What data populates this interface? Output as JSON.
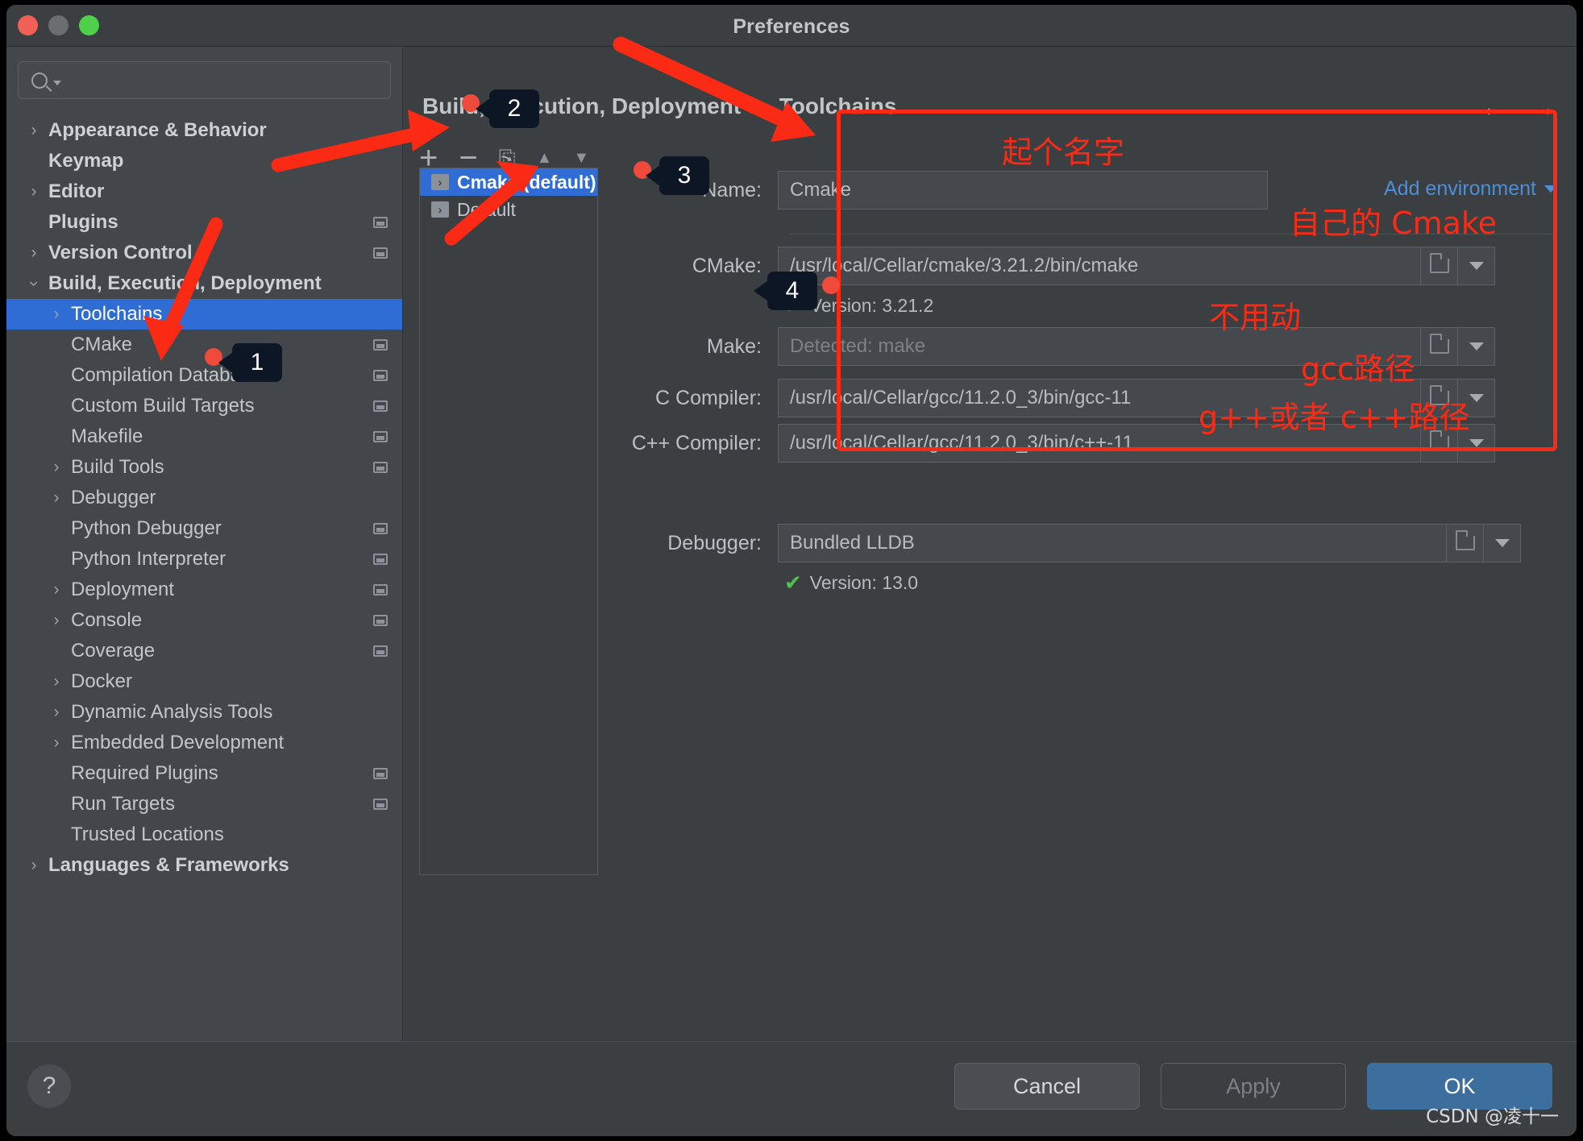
{
  "window": {
    "title": "Preferences",
    "traffic_lights": [
      "close",
      "minimize",
      "zoom"
    ]
  },
  "sidebar": {
    "search": {
      "value": "",
      "placeholder": ""
    },
    "items": [
      {
        "label": "Appearance & Behavior",
        "chevron": "right",
        "bold": true,
        "indent": 0,
        "mini": false,
        "selected": false
      },
      {
        "label": "Keymap",
        "chevron": "none",
        "bold": true,
        "indent": 0,
        "mini": false,
        "selected": false
      },
      {
        "label": "Editor",
        "chevron": "right",
        "bold": true,
        "indent": 0,
        "mini": false,
        "selected": false
      },
      {
        "label": "Plugins",
        "chevron": "none",
        "bold": true,
        "indent": 0,
        "mini": true,
        "selected": false
      },
      {
        "label": "Version Control",
        "chevron": "right",
        "bold": true,
        "indent": 0,
        "mini": true,
        "selected": false
      },
      {
        "label": "Build, Execution, Deployment",
        "chevron": "down",
        "bold": true,
        "indent": 0,
        "mini": false,
        "selected": false
      },
      {
        "label": "Toolchains",
        "chevron": "right",
        "bold": false,
        "indent": 1,
        "mini": false,
        "selected": true
      },
      {
        "label": "CMake",
        "chevron": "none",
        "bold": false,
        "indent": 1,
        "mini": true,
        "selected": false
      },
      {
        "label": "Compilation Database",
        "chevron": "none",
        "bold": false,
        "indent": 1,
        "mini": true,
        "selected": false
      },
      {
        "label": "Custom Build Targets",
        "chevron": "none",
        "bold": false,
        "indent": 1,
        "mini": true,
        "selected": false
      },
      {
        "label": "Makefile",
        "chevron": "none",
        "bold": false,
        "indent": 1,
        "mini": true,
        "selected": false
      },
      {
        "label": "Build Tools",
        "chevron": "right",
        "bold": false,
        "indent": 1,
        "mini": true,
        "selected": false
      },
      {
        "label": "Debugger",
        "chevron": "right",
        "bold": false,
        "indent": 1,
        "mini": false,
        "selected": false
      },
      {
        "label": "Python Debugger",
        "chevron": "none",
        "bold": false,
        "indent": 1,
        "mini": true,
        "selected": false
      },
      {
        "label": "Python Interpreter",
        "chevron": "none",
        "bold": false,
        "indent": 1,
        "mini": true,
        "selected": false
      },
      {
        "label": "Deployment",
        "chevron": "right",
        "bold": false,
        "indent": 1,
        "mini": true,
        "selected": false
      },
      {
        "label": "Console",
        "chevron": "right",
        "bold": false,
        "indent": 1,
        "mini": true,
        "selected": false
      },
      {
        "label": "Coverage",
        "chevron": "none",
        "bold": false,
        "indent": 1,
        "mini": true,
        "selected": false
      },
      {
        "label": "Docker",
        "chevron": "right",
        "bold": false,
        "indent": 1,
        "mini": false,
        "selected": false
      },
      {
        "label": "Dynamic Analysis Tools",
        "chevron": "right",
        "bold": false,
        "indent": 1,
        "mini": false,
        "selected": false
      },
      {
        "label": "Embedded Development",
        "chevron": "right",
        "bold": false,
        "indent": 1,
        "mini": false,
        "selected": false
      },
      {
        "label": "Required Plugins",
        "chevron": "none",
        "bold": false,
        "indent": 1,
        "mini": true,
        "selected": false
      },
      {
        "label": "Run Targets",
        "chevron": "none",
        "bold": false,
        "indent": 1,
        "mini": true,
        "selected": false
      },
      {
        "label": "Trusted Locations",
        "chevron": "none",
        "bold": false,
        "indent": 1,
        "mini": false,
        "selected": false
      },
      {
        "label": "Languages & Frameworks",
        "chevron": "right",
        "bold": true,
        "indent": 0,
        "mini": false,
        "selected": false
      }
    ]
  },
  "breadcrumb": {
    "root": "Build, Execution, Deployment",
    "separator": "›",
    "leaf": "Toolchains"
  },
  "nav": {
    "back": "←",
    "forward": "→"
  },
  "list_toolbar": {
    "add": "+",
    "remove": "−",
    "copy": "⎘",
    "move_up": "▲",
    "move_down": "▼"
  },
  "toolchain_list": [
    {
      "label": "Cmake (default)",
      "icon": "toolchain-icon",
      "selected": true
    },
    {
      "label": "Default",
      "icon": "toolchain-icon",
      "selected": false
    }
  ],
  "form": {
    "add_environment": "Add environment",
    "rows": [
      {
        "label": "Name:",
        "value": "Cmake",
        "muted": false,
        "kind": "name"
      },
      {
        "label": "CMake:",
        "value": "/usr/local/Cellar/cmake/3.21.2/bin/cmake",
        "muted": false,
        "kind": "path"
      },
      {
        "label": "Make:",
        "value": "Detected: make",
        "muted": true,
        "kind": "path"
      },
      {
        "label": "C Compiler:",
        "value": "/usr/local/Cellar/gcc/11.2.0_3/bin/gcc-11",
        "muted": false,
        "kind": "path"
      },
      {
        "label": "C++ Compiler:",
        "value": "/usr/local/Cellar/gcc/11.2.0_3/bin/c++-11",
        "muted": false,
        "kind": "path"
      },
      {
        "label": "Debugger:",
        "value": "Bundled LLDB",
        "muted": false,
        "kind": "debug"
      }
    ],
    "cmake_version": "Version: 3.21.2",
    "debugger_version": "Version: 13.0",
    "check_glyph": "✔"
  },
  "footer": {
    "help": "?",
    "cancel": "Cancel",
    "apply": "Apply",
    "ok": "OK"
  },
  "annotations": {
    "badges": [
      "1",
      "2",
      "3",
      "4"
    ],
    "notes": [
      {
        "text": "起个名字",
        "for": "name-field"
      },
      {
        "text": "自己的 Cmake",
        "for": "cmake-field"
      },
      {
        "text": "不用动",
        "for": "make-field"
      },
      {
        "text": "gcc路径",
        "for": "c-compiler-field"
      },
      {
        "text": "g++或者 c++路径",
        "for": "cxx-compiler-field"
      }
    ],
    "highlight_color": "#fb2a14"
  },
  "watermark": "CSDN @凌十一"
}
